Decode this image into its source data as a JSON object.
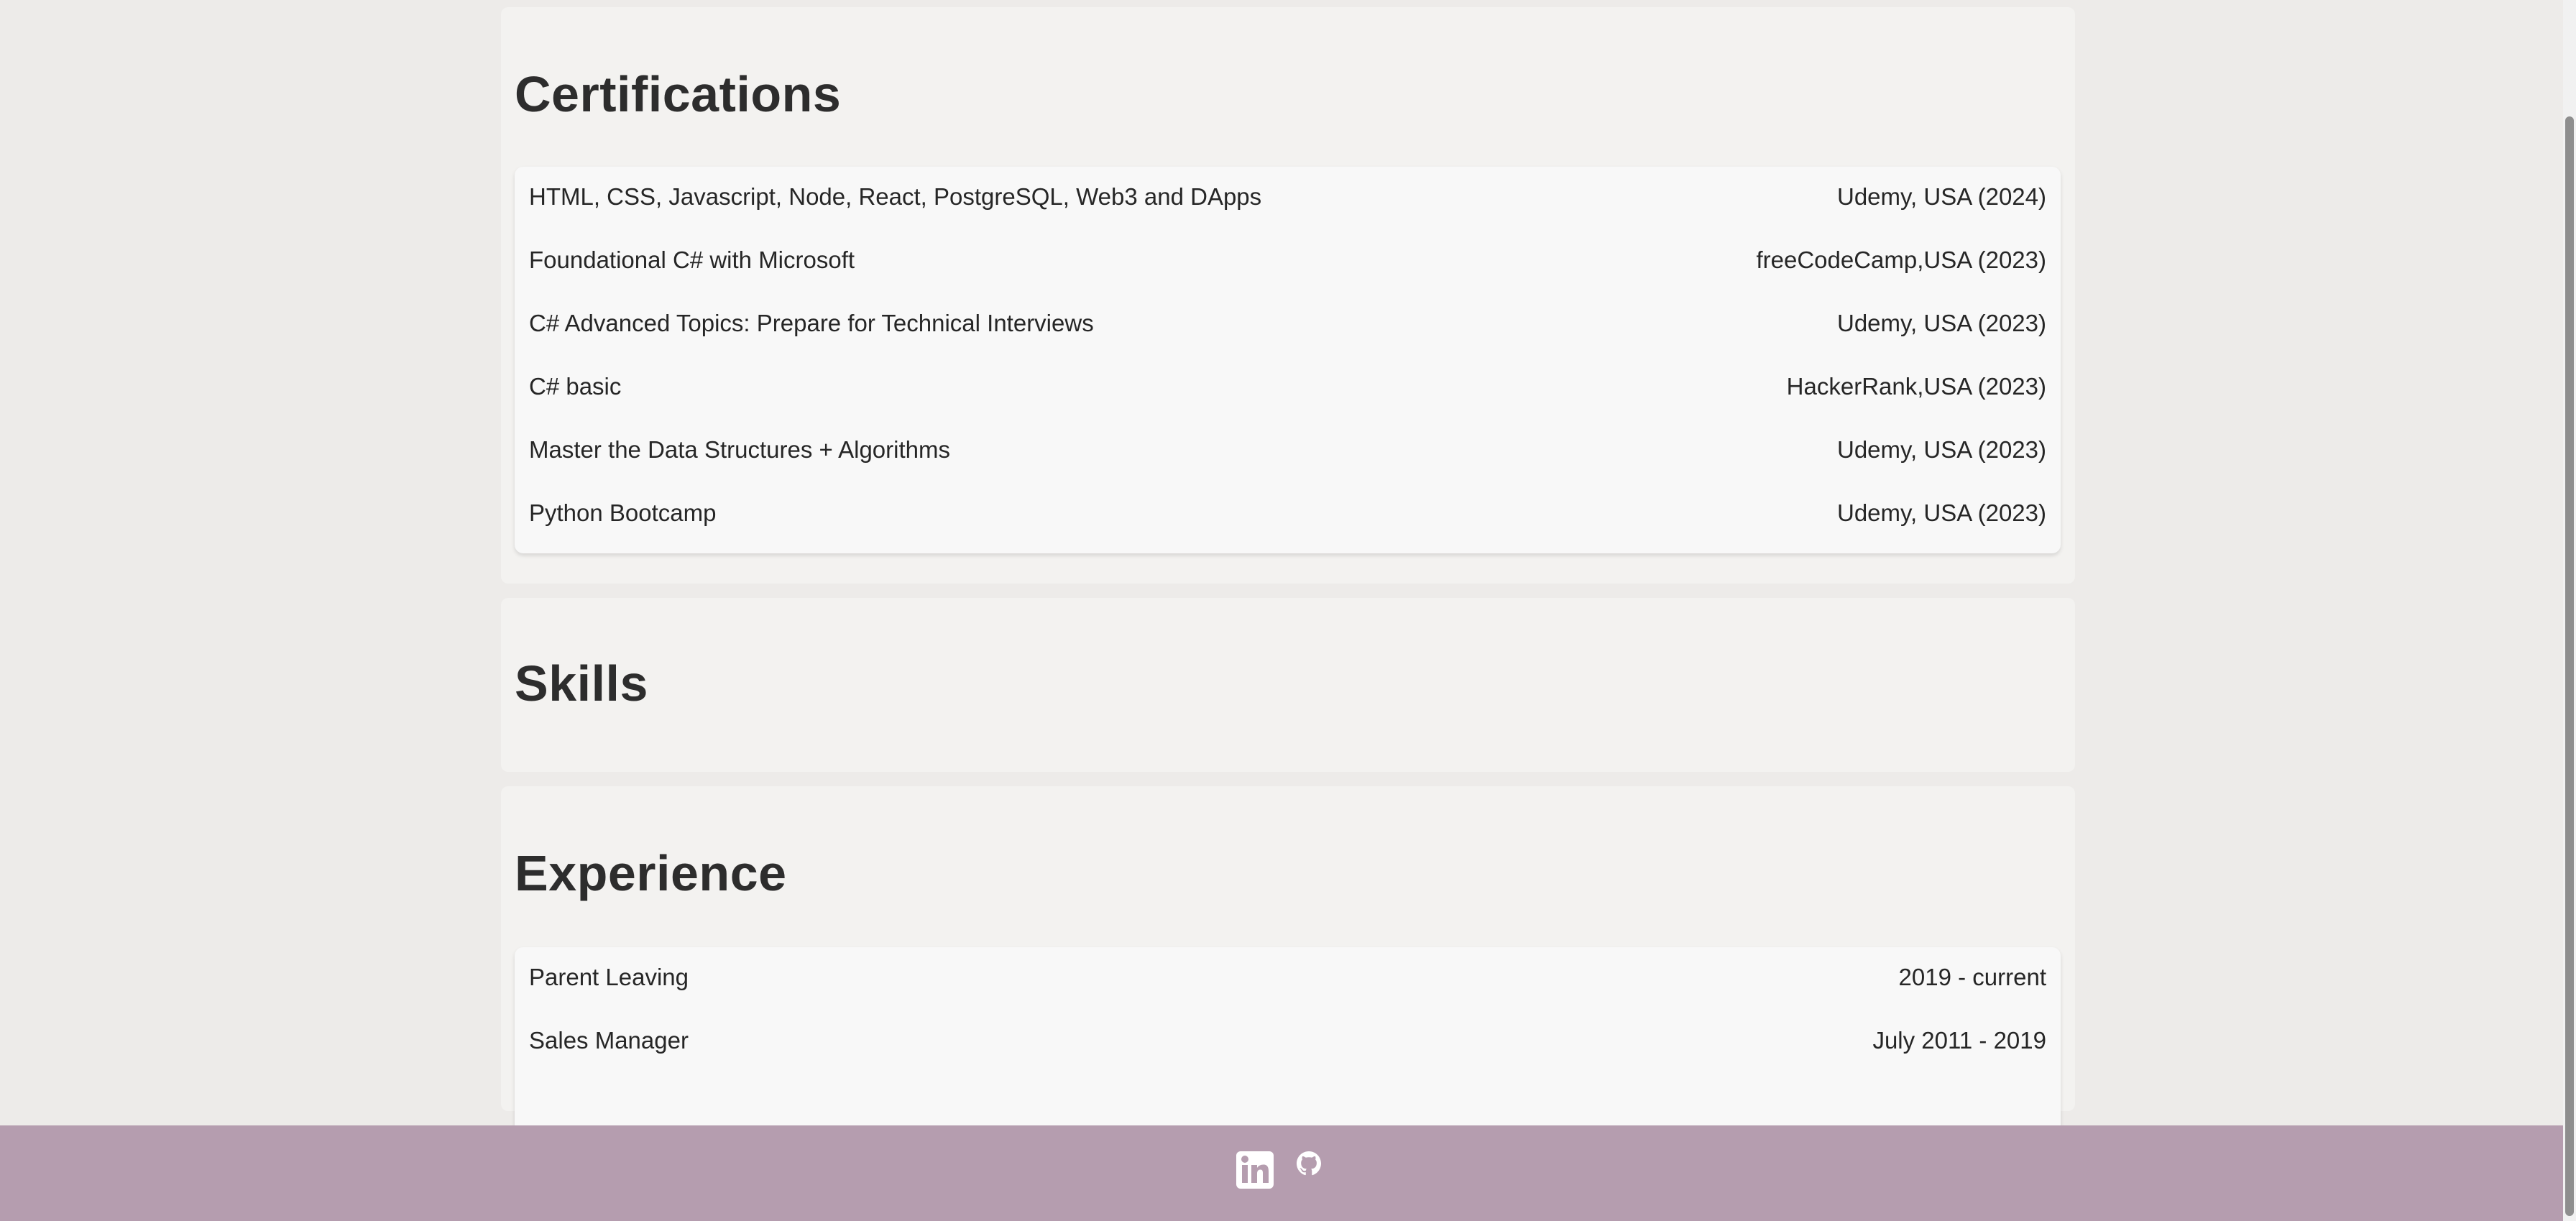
{
  "certifications": {
    "title": "Certifications",
    "items": [
      {
        "name": "HTML, CSS, Javascript, Node, React, PostgreSQL, Web3 and DApps",
        "issuer": "Udemy, USA (2024)"
      },
      {
        "name": "Foundational C# with Microsoft",
        "issuer": "freeCodeCamp,USA (2023)"
      },
      {
        "name": "C# Advanced Topics: Prepare for Technical Interviews",
        "issuer": "Udemy, USA (2023)"
      },
      {
        "name": "C# basic",
        "issuer": "HackerRank,USA (2023)"
      },
      {
        "name": "Master the Data Structures + Algorithms",
        "issuer": "Udemy, USA (2023)"
      },
      {
        "name": "Python Bootcamp",
        "issuer": "Udemy, USA (2023)"
      }
    ]
  },
  "skills": {
    "title": "Skills"
  },
  "experience": {
    "title": "Experience",
    "items": [
      {
        "role": "Parent Leaving",
        "period": "2019 - current"
      },
      {
        "role": "Sales Manager",
        "period": "July 2011 - 2019"
      }
    ]
  },
  "footer": {
    "icons": [
      "linkedin-icon",
      "github-icon"
    ],
    "background": "#b59daf"
  },
  "colors": {
    "page_background": "#edebe9",
    "section_background": "#f3f2f0",
    "list_background": "#f8f8f8"
  }
}
